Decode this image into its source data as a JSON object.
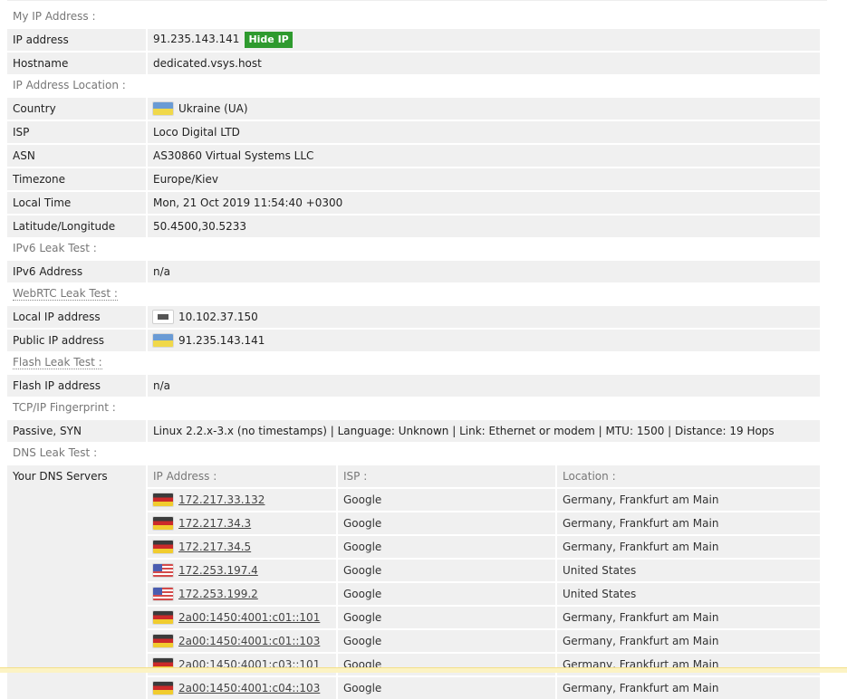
{
  "sections": {
    "my_ip": "My IP Address :",
    "location": "IP Address Location :",
    "ipv6": "IPv6 Leak Test :",
    "webrtc": "WebRTC Leak Test :",
    "flash": "Flash Leak Test :",
    "tcpip": "TCP/IP Fingerprint :",
    "dns": "DNS Leak Test :"
  },
  "my_ip": {
    "ip_label": "IP address",
    "ip_value": "91.235.143.141",
    "hide_ip_button": "Hide IP",
    "hostname_label": "Hostname",
    "hostname_value": "dedicated.vsys.host"
  },
  "location": {
    "country_label": "Country",
    "country_value": "Ukraine (UA)",
    "country_flag": "flag-ua",
    "isp_label": "ISP",
    "isp_value": "Loco Digital LTD",
    "asn_label": "ASN",
    "asn_value": "AS30860 Virtual Systems LLC",
    "timezone_label": "Timezone",
    "timezone_value": "Europe/Kiev",
    "localtime_label": "Local Time",
    "localtime_value": "Mon, 21 Oct 2019 11:54:40 +0300",
    "latlon_label": "Latitude/Longitude",
    "latlon_value": "50.4500,30.5233"
  },
  "ipv6": {
    "label": "IPv6 Address",
    "value": "n/a"
  },
  "webrtc": {
    "local_label": "Local IP address",
    "local_value": "10.102.37.150",
    "local_icon": "lan-icon",
    "public_label": "Public IP address",
    "public_value": "91.235.143.141",
    "public_flag": "flag-ua"
  },
  "flash": {
    "label": "Flash IP address",
    "value": "n/a"
  },
  "tcpip": {
    "label": "Passive, SYN",
    "value": "Linux 2.2.x-3.x (no timestamps) | Language: Unknown | Link: Ethernet or modem | MTU: 1500 | Distance: 19 Hops"
  },
  "dns": {
    "label": "Your DNS Servers",
    "headers": [
      "IP Address :",
      "ISP :",
      "Location :"
    ],
    "servers": [
      {
        "ip": "172.217.33.132",
        "isp": "Google",
        "location": "Germany, Frankfurt am Main",
        "flag": "de"
      },
      {
        "ip": "172.217.34.3",
        "isp": "Google",
        "location": "Germany, Frankfurt am Main",
        "flag": "de"
      },
      {
        "ip": "172.217.34.5",
        "isp": "Google",
        "location": "Germany, Frankfurt am Main",
        "flag": "de"
      },
      {
        "ip": "172.253.197.4",
        "isp": "Google",
        "location": "United States",
        "flag": "us"
      },
      {
        "ip": "172.253.199.2",
        "isp": "Google",
        "location": "United States",
        "flag": "us"
      },
      {
        "ip": "2a00:1450:4001:c01::101",
        "isp": "Google",
        "location": "Germany, Frankfurt am Main",
        "flag": "de"
      },
      {
        "ip": "2a00:1450:4001:c01::103",
        "isp": "Google",
        "location": "Germany, Frankfurt am Main",
        "flag": "de"
      },
      {
        "ip": "2a00:1450:4001:c03::101",
        "isp": "Google",
        "location": "Germany, Frankfurt am Main",
        "flag": "de"
      },
      {
        "ip": "2a00:1450:4001:c04::103",
        "isp": "Google",
        "location": "Germany, Frankfurt am Main",
        "flag": "de"
      }
    ]
  },
  "colors": {
    "row_bg": "#f0f0f0",
    "section_text": "#777777",
    "hide_button_bg": "#2e9a2e",
    "bottom_bar": "#fcf3c4"
  }
}
